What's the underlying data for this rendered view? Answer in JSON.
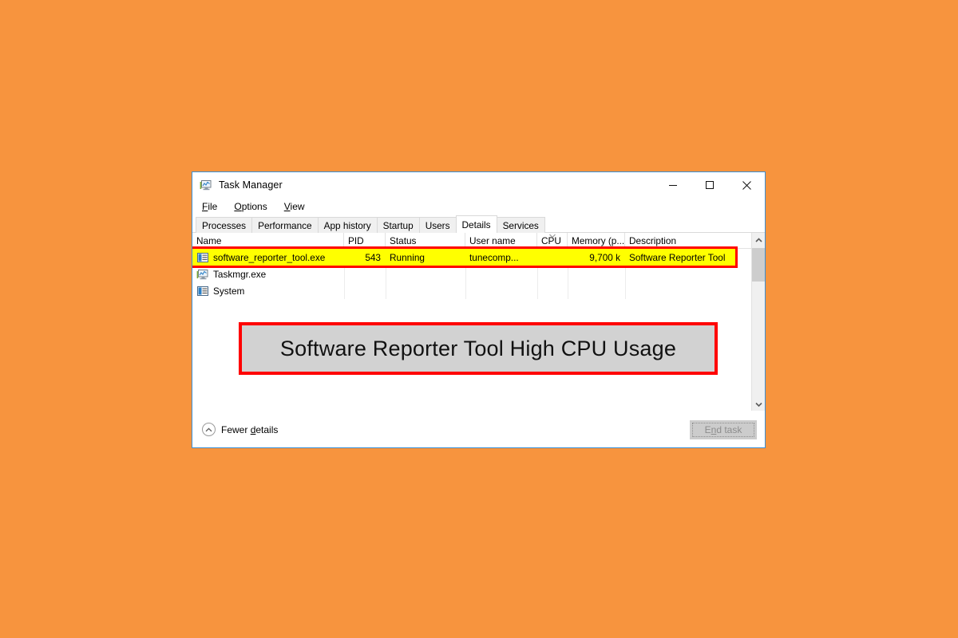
{
  "background_color": "#F7943E",
  "window": {
    "title": "Task Manager",
    "icon": "task-manager-icon",
    "controls": {
      "minimize": "minimize-icon",
      "maximize": "maximize-icon",
      "close": "close-icon"
    }
  },
  "menu": {
    "items": [
      {
        "label": "File",
        "accel": "F"
      },
      {
        "label": "Options",
        "accel": "O"
      },
      {
        "label": "View",
        "accel": "V"
      }
    ]
  },
  "tabs": [
    {
      "label": "Processes",
      "active": false
    },
    {
      "label": "Performance",
      "active": false
    },
    {
      "label": "App history",
      "active": false
    },
    {
      "label": "Startup",
      "active": false
    },
    {
      "label": "Users",
      "active": false
    },
    {
      "label": "Details",
      "active": true
    },
    {
      "label": "Services",
      "active": false
    }
  ],
  "table": {
    "columns": [
      {
        "key": "name",
        "label": "Name",
        "sorted": false
      },
      {
        "key": "pid",
        "label": "PID",
        "sorted": false
      },
      {
        "key": "status",
        "label": "Status",
        "sorted": false
      },
      {
        "key": "user",
        "label": "User name",
        "sorted": false
      },
      {
        "key": "cpu",
        "label": "CPU",
        "sorted": true
      },
      {
        "key": "memory",
        "label": "Memory (p...",
        "sorted": false
      },
      {
        "key": "desc",
        "label": "Description",
        "sorted": false
      }
    ],
    "rows": [
      {
        "icon": "application-icon",
        "name": "software_reporter_tool.exe",
        "pid": "543",
        "status": "Running",
        "user": "tunecomp...",
        "cpu": "",
        "memory": "9,700 k",
        "desc": "Software Reporter Tool",
        "highlighted": true
      },
      {
        "icon": "task-manager-icon",
        "name": "Taskmgr.exe",
        "pid": "",
        "status": "",
        "user": "",
        "cpu": "",
        "memory": "",
        "desc": "",
        "highlighted": false
      },
      {
        "icon": "application-icon",
        "name": "System",
        "pid": "",
        "status": "",
        "user": "",
        "cpu": "",
        "memory": "",
        "desc": "",
        "highlighted": false
      }
    ]
  },
  "scrollbar": {
    "up_arrow": "chevron-up-icon",
    "down_arrow": "chevron-down-icon"
  },
  "overlay": {
    "text": "Software Reporter Tool High CPU Usage",
    "border_color": "#FF0000",
    "fill_color": "#d2d2d2"
  },
  "footer": {
    "fewer_details": {
      "icon": "chevron-up-circle-icon",
      "label_before": "Fewer ",
      "accel": "d",
      "label_after": "etails"
    },
    "end_task": {
      "label_before": "E",
      "accel": "n",
      "label_after": "d task",
      "enabled": false
    }
  },
  "highlight": {
    "row_fill": "#FFFF00",
    "row_border": "#FF0000"
  }
}
